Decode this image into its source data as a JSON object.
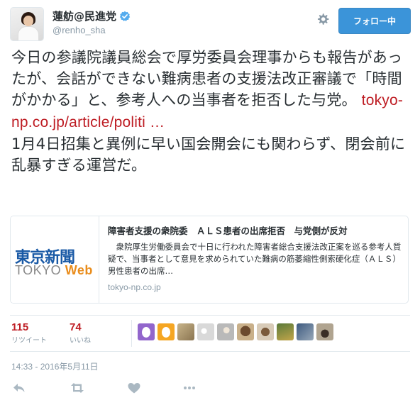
{
  "header": {
    "display_name": "蓮舫@民進党",
    "handle": "@renho_sha",
    "follow_label": "フォロー中",
    "icons": [
      "verified-badge-icon",
      "gear-icon"
    ],
    "accent_color": "#3b94d9"
  },
  "tweet": {
    "text_part1": "今日の参議院議員総会で厚労委員会理事からも報告があったが、会話ができない難病患者の支援法改正審議で「時間がかかる」と、参考人への当事者を拒否した与党。",
    "link_text": "tokyo-np.co.jp/article/politi …",
    "text_part2": "1月4日招集と異例に早い国会開会にも関わらず、閉会前に乱暴すぎる運営だ。",
    "link_color": "#be1d24"
  },
  "card": {
    "logo_jp": "東京新聞",
    "logo_en_tokyo": "TOKYO",
    "logo_en_web": "Web",
    "title": "障害者支援の衆院委　ＡＬＳ患者の出席拒否　与党側が反対",
    "description": "　衆院厚生労働委員会で十日に行われた障害者総合支援法改正案を巡る参考人質疑で、当事者として意見を求められていた難病の筋萎縮性側索硬化症（ＡＬＳ）男性患者の出席…",
    "domain": "tokyo-np.co.jp"
  },
  "stats": {
    "retweets_count": "115",
    "retweets_label": "リツイート",
    "likes_count": "74",
    "likes_label": "いいね"
  },
  "timestamp": "14:33 - 2016年5月11日",
  "actions": [
    "reply-icon",
    "retweet-icon",
    "like-icon",
    "more-icon"
  ]
}
